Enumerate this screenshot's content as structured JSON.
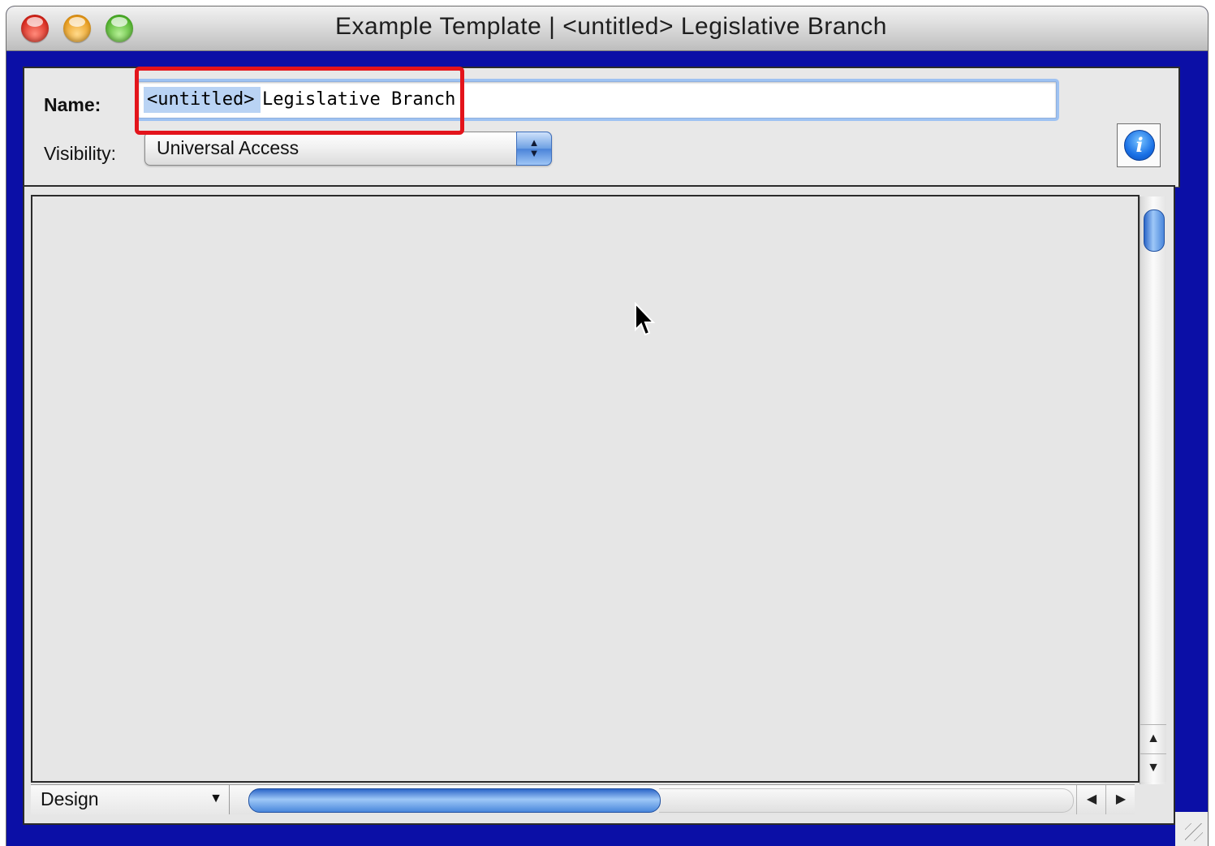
{
  "window": {
    "title": "Example Template | <untitled>  Legislative Branch"
  },
  "form": {
    "name_label": "Name:",
    "name_prefix": "<untitled>",
    "name_value": "Legislative Branch",
    "visibility_label": "Visibility:",
    "visibility_value": "Universal Access"
  },
  "layout_menu": {
    "mode": "Design"
  },
  "icons": {
    "info": "i"
  },
  "colors": {
    "window_border": "#0b0fa6",
    "highlight": "#e3141b",
    "selection": "#b9d3f4",
    "aqua_blue": "#4a87dc"
  }
}
